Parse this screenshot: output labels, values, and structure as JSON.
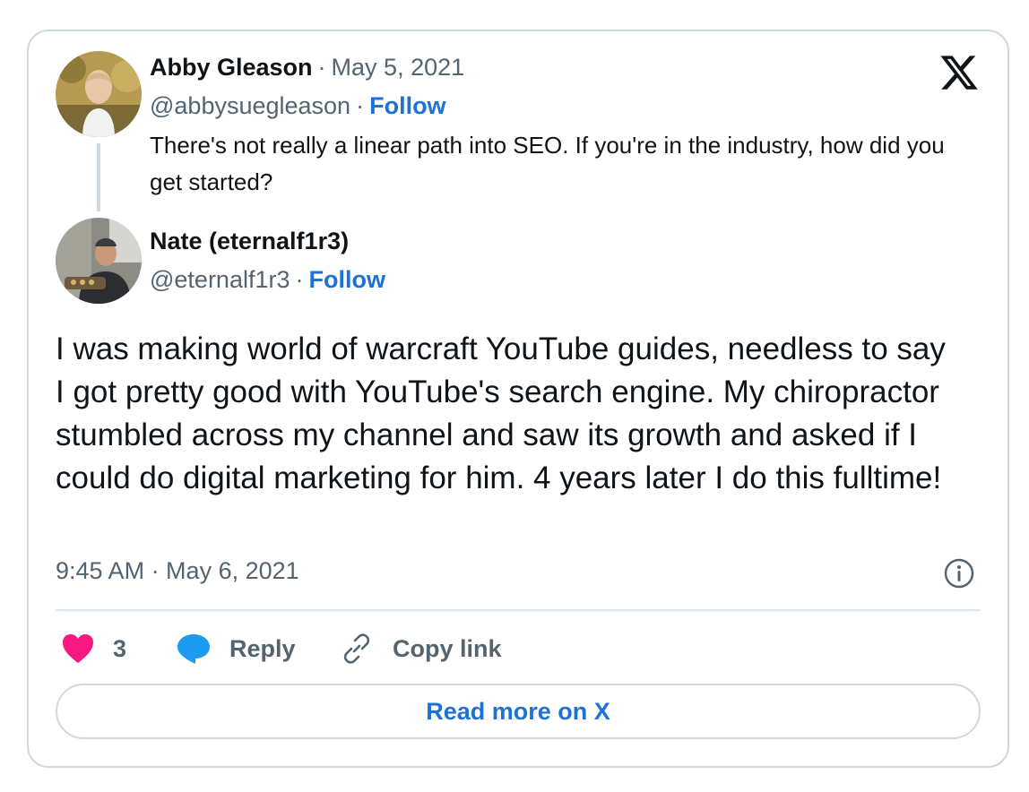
{
  "quoted_tweet": {
    "author_name": "Abby Gleason",
    "date": "May 5, 2021",
    "handle": "@abbysuegleason",
    "follow_label": "Follow",
    "text": "There's not really a linear path into SEO. If you're in the industry, how did you get started?"
  },
  "reply_tweet": {
    "author_name": "Nate (eternalf1r3)",
    "handle": "@eternalf1r3",
    "follow_label": "Follow",
    "text": "I was making world of warcraft YouTube guides, needless to say I got pretty good with YouTube's search engine. My chiropractor stumbled across my channel and saw its growth and asked if I could do digital marketing for him. 4 years later I do this fulltime!",
    "timestamp": "9:45 AM · May 6, 2021"
  },
  "actions": {
    "like_count": "3",
    "reply_label": "Reply",
    "copy_link_label": "Copy link"
  },
  "read_more_label": "Read more on X",
  "separator": "·",
  "colors": {
    "link_blue": "#1d72d6",
    "like_pink": "#f91880",
    "reply_blue": "#1d9bf0",
    "muted": "#536471",
    "border": "#cfd9de"
  },
  "icons": [
    "x-logo-icon",
    "info-icon",
    "heart-icon",
    "reply-bubble-icon",
    "link-icon"
  ]
}
